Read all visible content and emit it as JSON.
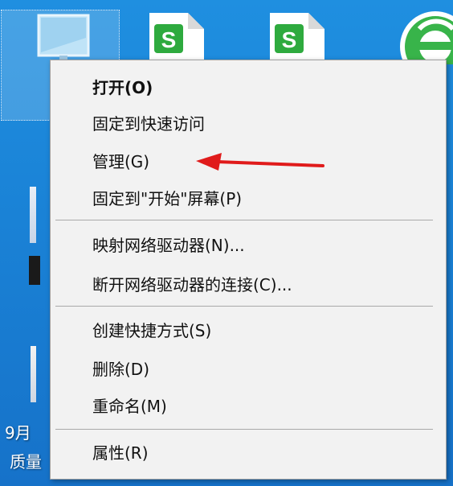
{
  "desktop": {
    "date_label": "9月",
    "quality_label": "质量"
  },
  "context_menu": {
    "items": [
      {
        "label": "打开(O)"
      },
      {
        "label": "固定到快速访问"
      },
      {
        "label": "管理(G)"
      },
      {
        "label": "固定到\"开始\"屏幕(P)"
      },
      {
        "label": "映射网络驱动器(N)..."
      },
      {
        "label": "断开网络驱动器的连接(C)..."
      },
      {
        "label": "创建快捷方式(S)"
      },
      {
        "label": "删除(D)"
      },
      {
        "label": "重命名(M)"
      },
      {
        "label": "属性(R)"
      }
    ]
  },
  "icons": {
    "selected_desktop_icon": "computer-monitor-icon",
    "doc_icon": "wps-doc-icon",
    "browser_icon": "browser-icon",
    "annotation": "red-arrow-annotation"
  },
  "colors": {
    "desktop_blue": "#1a82d6",
    "menu_bg": "#f2f2f2",
    "wps_green": "#2eaa3e",
    "arrow_red": "#e01b1b"
  }
}
